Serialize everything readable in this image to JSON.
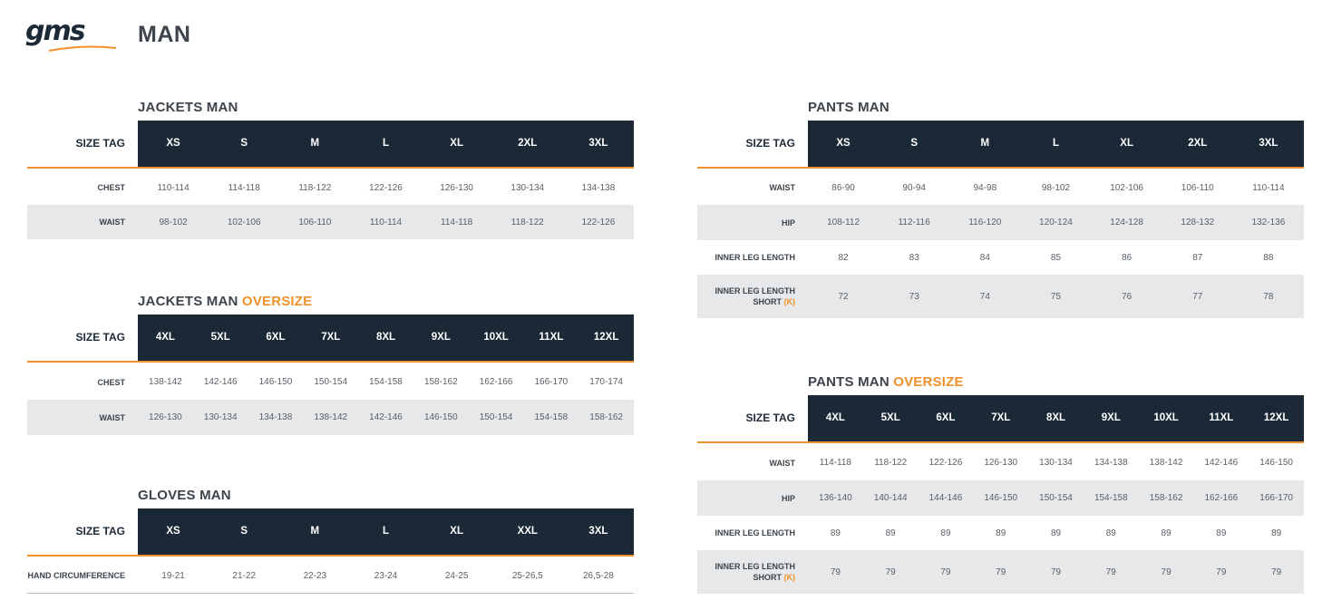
{
  "brand": {
    "logo_text": "gms",
    "brand_color": "#1b2937",
    "accent_color": "#f0902a"
  },
  "page": {
    "title": "MAN"
  },
  "jackets": {
    "title": "JACKETS MAN",
    "size_tag_label": "SIZE TAG",
    "sizes": [
      "XS",
      "S",
      "M",
      "L",
      "XL",
      "2XL",
      "3XL"
    ],
    "rows": [
      {
        "label": "CHEST",
        "values": [
          "110-114",
          "114-118",
          "118-122",
          "122-126",
          "126-130",
          "130-134",
          "134-138"
        ]
      },
      {
        "label": "WAIST",
        "values": [
          "98-102",
          "102-106",
          "106-110",
          "110-114",
          "114-118",
          "118-122",
          "122-126"
        ]
      }
    ]
  },
  "jackets_oversize": {
    "title": "JACKETS MAN",
    "title_accent": "OVERSIZE",
    "size_tag_label": "SIZE TAG",
    "sizes": [
      "4XL",
      "5XL",
      "6XL",
      "7XL",
      "8XL",
      "9XL",
      "10XL",
      "11XL",
      "12XL"
    ],
    "rows": [
      {
        "label": "CHEST",
        "values": [
          "138-142",
          "142-146",
          "146-150",
          "150-154",
          "154-158",
          "158-162",
          "162-166",
          "166-170",
          "170-174"
        ]
      },
      {
        "label": "WAIST",
        "values": [
          "126-130",
          "130-134",
          "134-138",
          "138-142",
          "142-146",
          "146-150",
          "150-154",
          "154-158",
          "158-162"
        ]
      }
    ]
  },
  "gloves": {
    "title": "GLOVES MAN",
    "size_tag_label": "SIZE TAG",
    "sizes": [
      "XS",
      "S",
      "M",
      "L",
      "XL",
      "XXL",
      "3XL"
    ],
    "rows": [
      {
        "label": "HAND CIRCUMFERENCE",
        "values": [
          "19-21",
          "21-22",
          "22-23",
          "23-24",
          "24-25",
          "25-26,5",
          "26,5-28"
        ]
      }
    ]
  },
  "pants": {
    "title": "PANTS MAN",
    "size_tag_label": "SIZE TAG",
    "sizes": [
      "XS",
      "S",
      "M",
      "L",
      "XL",
      "2XL",
      "3XL"
    ],
    "rows": [
      {
        "label": "WAIST",
        "values": [
          "86-90",
          "90-94",
          "94-98",
          "98-102",
          "102-106",
          "106-110",
          "110-114"
        ]
      },
      {
        "label": "HIP",
        "values": [
          "108-112",
          "112-116",
          "116-120",
          "120-124",
          "124-128",
          "128-132",
          "132-136"
        ]
      },
      {
        "label": "INNER LEG LENGTH",
        "values": [
          "82",
          "83",
          "84",
          "85",
          "86",
          "87",
          "88"
        ]
      },
      {
        "label": "INNER LEG LENGTH",
        "label_line2": "SHORT",
        "label_accent": "(K)",
        "values": [
          "72",
          "73",
          "74",
          "75",
          "76",
          "77",
          "78"
        ]
      }
    ]
  },
  "pants_oversize": {
    "title": "PANTS MAN",
    "title_accent": "OVERSIZE",
    "size_tag_label": "SIZE TAG",
    "sizes": [
      "4XL",
      "5XL",
      "6XL",
      "7XL",
      "8XL",
      "9XL",
      "10XL",
      "11XL",
      "12XL"
    ],
    "rows": [
      {
        "label": "WAIST",
        "values": [
          "114-118",
          "118-122",
          "122-126",
          "126-130",
          "130-134",
          "134-138",
          "138-142",
          "142-146",
          "146-150"
        ]
      },
      {
        "label": "HIP",
        "values": [
          "136-140",
          "140-144",
          "144-146",
          "146-150",
          "150-154",
          "154-158",
          "158-162",
          "162-166",
          "166-170"
        ]
      },
      {
        "label": "INNER LEG LENGTH",
        "values": [
          "89",
          "89",
          "89",
          "89",
          "89",
          "89",
          "89",
          "89",
          "89"
        ]
      },
      {
        "label": "INNER LEG LENGTH",
        "label_line2": "SHORT",
        "label_accent": "(K)",
        "values": [
          "79",
          "79",
          "79",
          "79",
          "79",
          "79",
          "79",
          "79",
          "79"
        ]
      }
    ]
  }
}
